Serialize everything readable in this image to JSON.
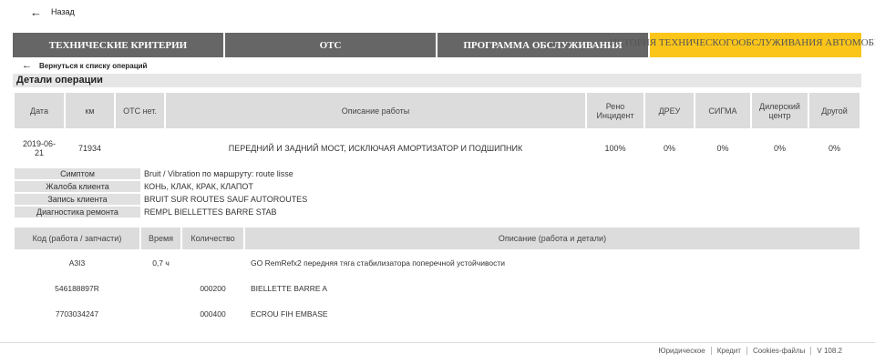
{
  "nav": {
    "back_label": "Назад"
  },
  "tabs": [
    {
      "label": "Технические критерии"
    },
    {
      "label": "ОТС"
    },
    {
      "label": "Программа обслуживания"
    },
    {
      "label_line1": "История технического",
      "label_line2": "обслуживания автомобилей"
    }
  ],
  "panel": {
    "return_label": "Вернуться к списку операций",
    "section_title": "Детали операции"
  },
  "ops_table": {
    "headers": [
      "Дата",
      "км",
      "ОТС нет.",
      "Описание работы",
      "Рено Инцидент",
      "ДРЕУ",
      "СИГМА",
      "Дилерский центр",
      "Другой"
    ],
    "row": {
      "date": "2019-06-21",
      "km": "71934",
      "ots": "",
      "description": "ПЕРЕДНИЙ И ЗАДНИЙ МОСТ, ИСКЛЮЧАЯ АМОРТИЗАТОР И ПОДШИПНИК",
      "renault": "100%",
      "dreu": "0%",
      "sigma": "0%",
      "dealer": "0%",
      "other": "0%"
    }
  },
  "info": [
    {
      "label": "Симптом",
      "value": "Bruit / Vibration по маршруту: route lisse"
    },
    {
      "label": "Жалоба клиента",
      "value": "КОНЬ, КЛАК, КРАК, КЛАПОТ"
    },
    {
      "label": "Запись клиента",
      "value": "BRUIT SUR ROUTES SAUF AUTOROUTES"
    },
    {
      "label": "Диагностика ремонта",
      "value": "REMPL BIELLETTES BARRE STAB"
    }
  ],
  "parts_table": {
    "headers": [
      "Код (работа / запчасти)",
      "Время",
      "Количество",
      "Описание (работа и детали)"
    ],
    "rows": [
      {
        "code": "A3I3",
        "time": "0,7 ч",
        "qty": "",
        "desc": "GO RemRefx2 передняя тяга стабилизатора поперечной устойчивости"
      },
      {
        "code": "546188897R",
        "time": "",
        "qty": "000200",
        "desc": "BIELLETTE BARRE A"
      },
      {
        "code": "7703034247",
        "time": "",
        "qty": "000400",
        "desc": "ECROU FIH EMBASE"
      }
    ]
  },
  "footer": {
    "legal": "Юридическое",
    "credit": "Кредит",
    "cookies": "Cookies-файлы",
    "version": "V 108.2"
  }
}
